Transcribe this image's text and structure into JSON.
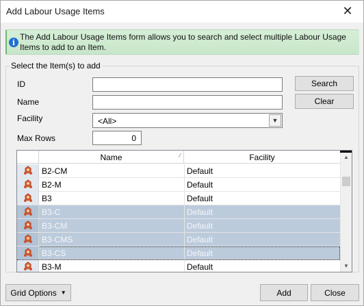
{
  "window": {
    "title": "Add Labour Usage Items",
    "close_icon": "close-icon"
  },
  "info": {
    "icon": "info-icon",
    "text": "The Add Labour Usage Items form allows you to search and select multiple Labour Usage Items to add to an Item."
  },
  "search": {
    "group_label": "Select the Item(s) to add",
    "id_label": "ID",
    "id_value": "",
    "name_label": "Name",
    "name_value": "",
    "facility_label": "Facility",
    "facility_value": "<All>",
    "max_rows_label": "Max Rows",
    "max_rows_value": "0",
    "search_button": "Search",
    "clear_button": "Clear"
  },
  "grid": {
    "columns": [
      "Name",
      "Facility"
    ],
    "rows": [
      {
        "name": "B2-CM",
        "facility": "Default",
        "selected": false
      },
      {
        "name": "B2-M",
        "facility": "Default",
        "selected": false
      },
      {
        "name": "B3",
        "facility": "Default",
        "selected": false
      },
      {
        "name": "B3-C",
        "facility": "Default",
        "selected": true
      },
      {
        "name": "B3-CM",
        "facility": "Default",
        "selected": true
      },
      {
        "name": "B3-CMS",
        "facility": "Default",
        "selected": true
      },
      {
        "name": "B3-CS",
        "facility": "Default",
        "selected": true,
        "focused": true
      },
      {
        "name": "B3-M",
        "facility": "Default",
        "selected": false
      }
    ]
  },
  "footer": {
    "grid_options": "Grid Options",
    "add": "Add",
    "close": "Close"
  }
}
